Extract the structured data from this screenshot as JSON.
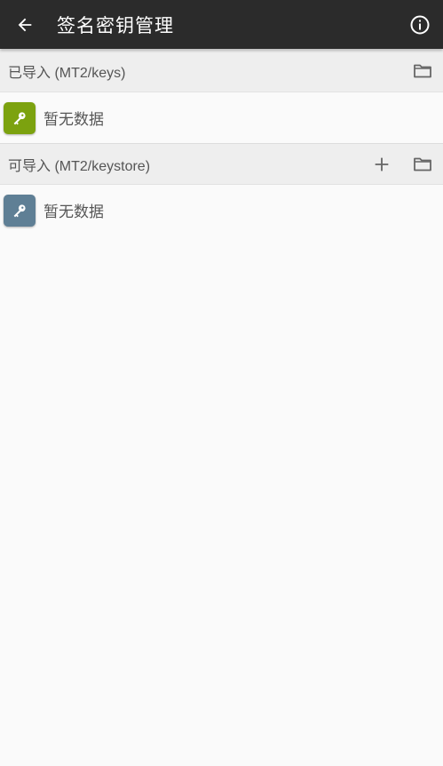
{
  "header": {
    "title": "签名密钥管理",
    "back_icon": "arrow-left-icon",
    "info_icon": "info-icon",
    "bg_color": "#2b2b2b"
  },
  "sections": [
    {
      "title": "已导入 (MT2/keys)",
      "actions": [
        "folder-icon"
      ],
      "empty_text": "暂无数据",
      "badge_color": "#7ca20f",
      "badge_icon": "key-icon"
    },
    {
      "title": "可导入 (MT2/keystore)",
      "actions": [
        "plus-icon",
        "folder-icon"
      ],
      "empty_text": "暂无数据",
      "badge_color": "#5f7f95",
      "badge_icon": "key-icon"
    }
  ]
}
